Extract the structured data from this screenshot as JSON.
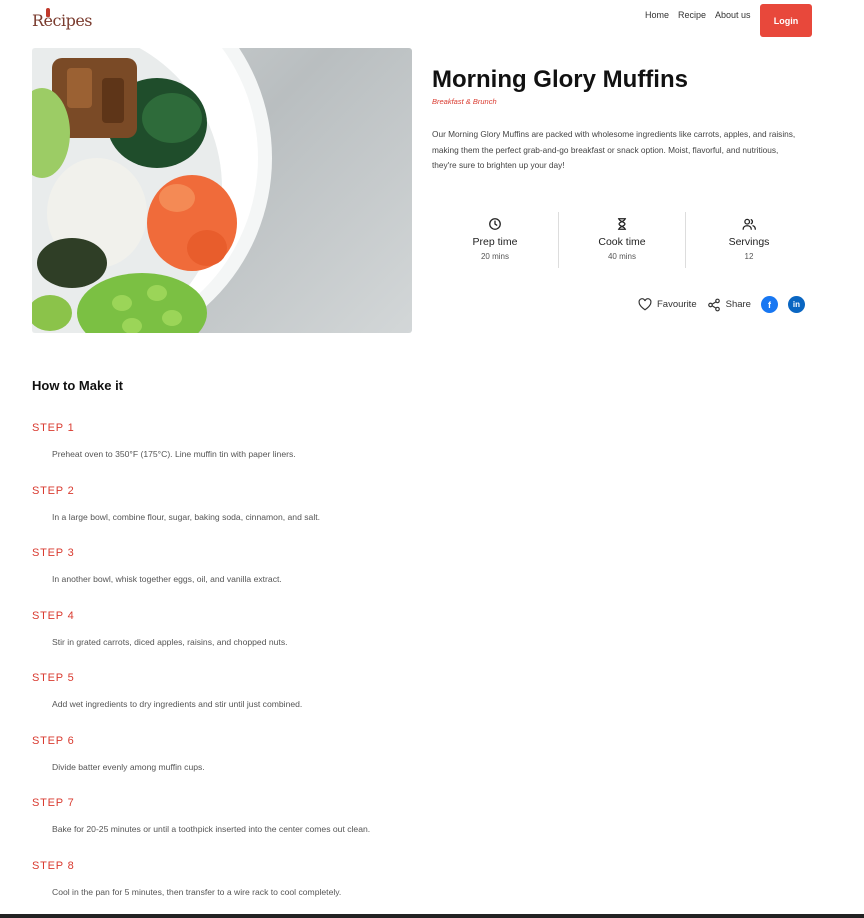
{
  "header": {
    "logo_text": "Recipes",
    "nav": [
      "Home",
      "Recipe",
      "About us"
    ],
    "login_label": "Login"
  },
  "recipe": {
    "title": "Morning Glory Muffins",
    "category": "Breakfast & Brunch",
    "description": "Our Morning Glory Muffins are packed with wholesome ingredients like carrots, apples, and raisins, making them the perfect grab-and-go breakfast or snack option. Moist, flavorful, and nutritious, they're sure to brighten up your day!",
    "stats": [
      {
        "icon": "clock-icon",
        "label": "Prep time",
        "value": "20 mins"
      },
      {
        "icon": "hourglass-icon",
        "label": "Cook time",
        "value": "40 mins"
      },
      {
        "icon": "users-icon",
        "label": "Servings",
        "value": "12"
      }
    ],
    "actions": {
      "favourite": "Favourite",
      "share": "Share"
    }
  },
  "how_to": {
    "heading": "How to Make it",
    "steps": [
      {
        "label": "STEP 1",
        "text": "Preheat oven to 350°F (175°C). Line muffin tin with paper liners."
      },
      {
        "label": "STEP 2",
        "text": "In a large bowl, combine flour, sugar, baking soda, cinnamon, and salt."
      },
      {
        "label": "STEP 3",
        "text": "In another bowl, whisk together eggs, oil, and vanilla extract."
      },
      {
        "label": "STEP 4",
        "text": "Stir in grated carrots, diced apples, raisins, and chopped nuts."
      },
      {
        "label": "STEP 5",
        "text": "Add wet ingredients to dry ingredients and stir until just combined."
      },
      {
        "label": "STEP 6",
        "text": "Divide batter evenly among muffin cups."
      },
      {
        "label": "STEP 7",
        "text": "Bake for 20-25 minutes or until a toothpick inserted into the center comes out clean."
      },
      {
        "label": "STEP 8",
        "text": "Cool in the pan for 5 minutes, then transfer to a wire rack to cool completely."
      }
    ]
  },
  "colors": {
    "accent": "#e8483b",
    "facebook": "#1877f2",
    "linkedin": "#0a66c2"
  }
}
